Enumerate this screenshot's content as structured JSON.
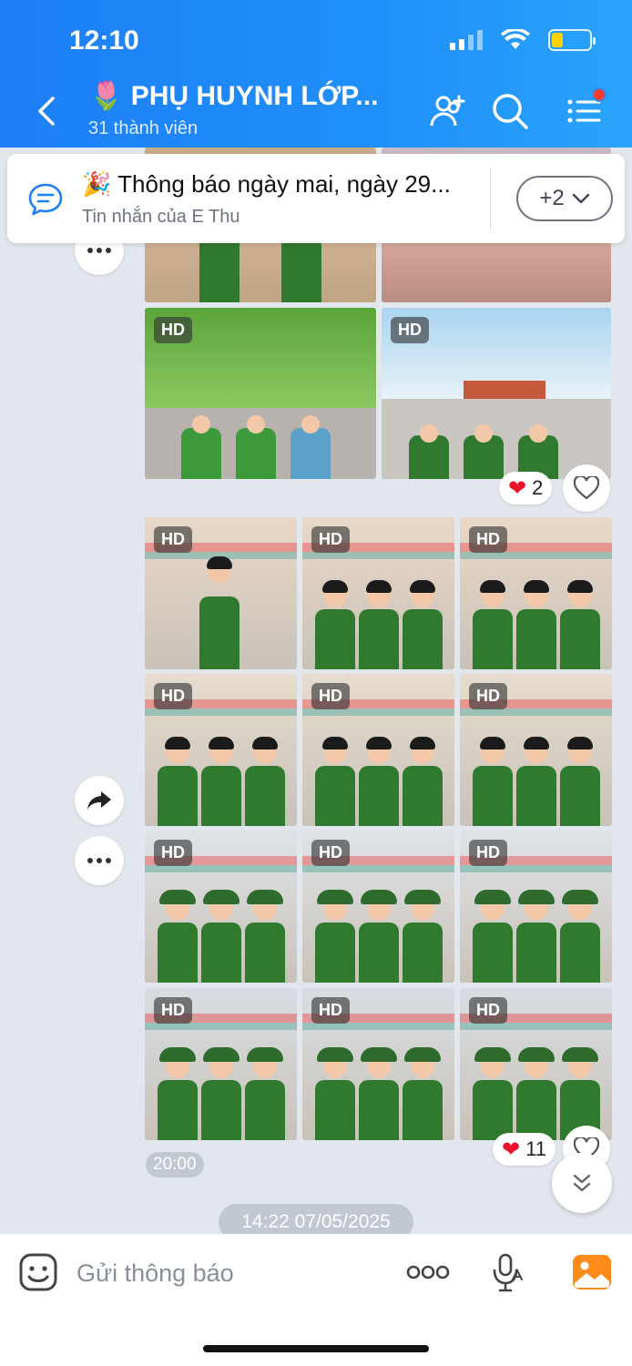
{
  "status_bar": {
    "time": "12:10"
  },
  "header": {
    "group_name": "🌷 PHỤ HUYNH LỚP...",
    "member_count": "31 thành viên"
  },
  "pinned": {
    "title": "🎉 Thông báo ngày mai, ngày 29...",
    "subtitle": "Tin nhắn của E Thu",
    "more_label": "+2"
  },
  "photos": {
    "hd_label": "HD"
  },
  "reactions": {
    "first_count": "2",
    "second_count": "11"
  },
  "message_time": "20:00",
  "date_separator": "14:22 07/05/2025",
  "composer": {
    "placeholder": "Gửi thông báo"
  },
  "colors": {
    "header_blue": "#1e7ff7",
    "accent_orange": "#ff8c1a",
    "heart_red": "#e8132b",
    "uniform_green": "#2f7a2e"
  }
}
